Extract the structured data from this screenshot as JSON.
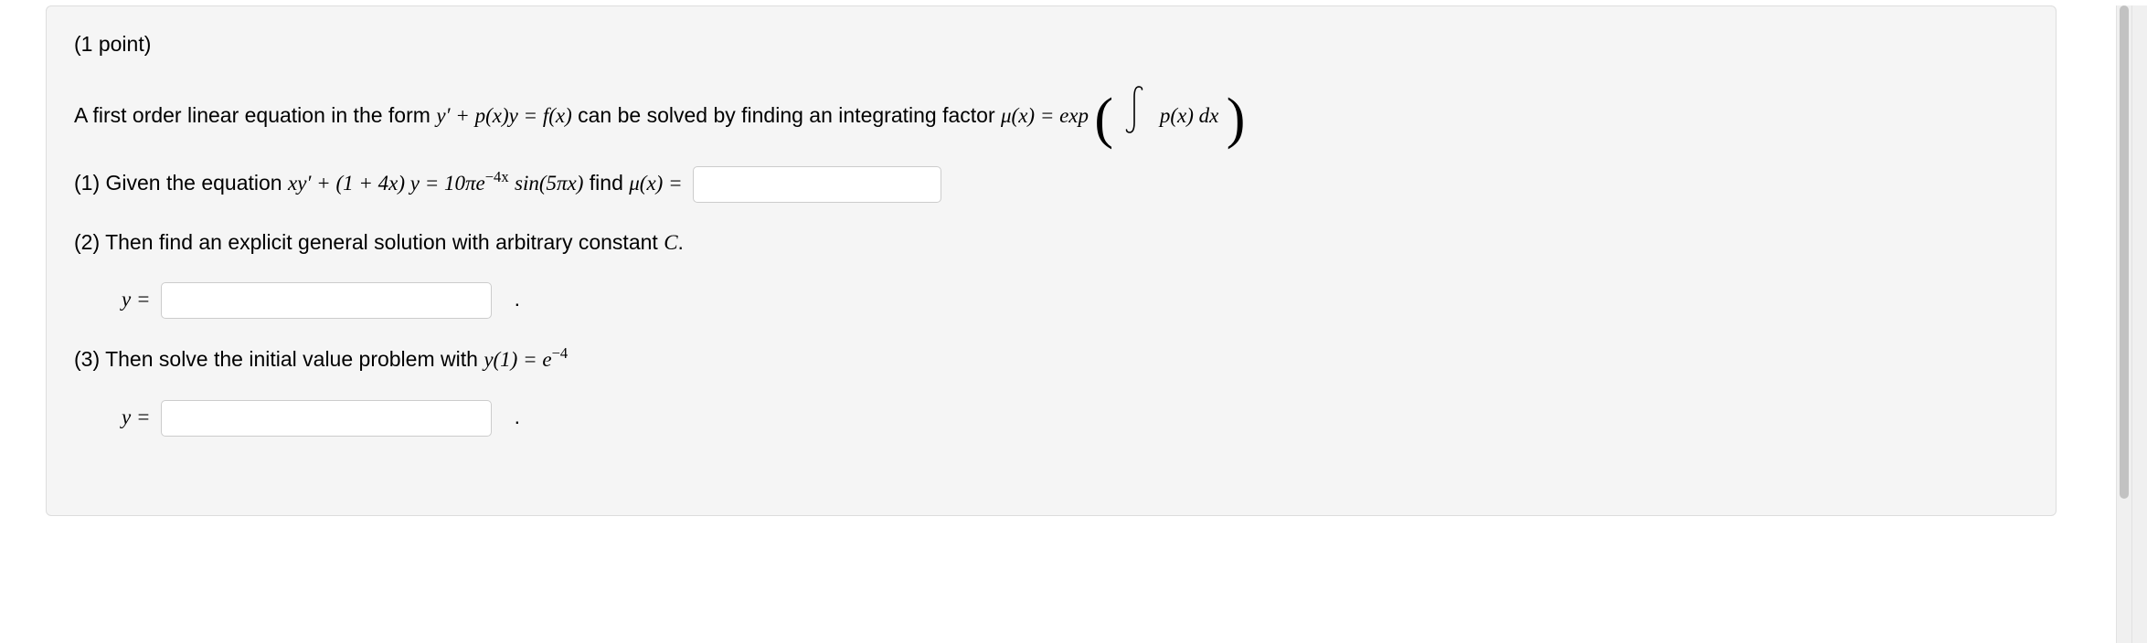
{
  "points_label": "(1 point)",
  "intro": {
    "pre": "A first order linear equation in the form ",
    "eq_lhs": "y′ + p(x)y = f(x)",
    "mid": " can be solved by finding an integrating factor ",
    "mu_eq": "μ(x) = exp",
    "int_body": "p(x) dx"
  },
  "q1": {
    "pre": "(1) Given the equation ",
    "eq": "xy′ + (1 + 4x) y = 10πe",
    "exp": "−4x",
    "mid": " sin(5πx)",
    "post": " find ",
    "mu": "μ(x) = "
  },
  "q2": {
    "text": "(2) Then find an explicit general solution with arbitrary constant ",
    "const": "C",
    "period": "."
  },
  "y_eq": "y = ",
  "q3": {
    "pre": "(3) Then solve the initial value problem with ",
    "cond": "y(1) = e",
    "exp": "−4"
  },
  "chart_data": {
    "type": "table",
    "title": "ODE integrating-factor problem",
    "equation_standard_form": "y' + p(x) y = f(x)",
    "integrating_factor_formula": "mu(x) = exp( ∫ p(x) dx )",
    "given_equation": "x y' + (1 + 4x) y = 10 π e^{-4x} sin(5 π x)",
    "unknowns": [
      "mu(x)",
      "general solution y(x,C)",
      "particular solution with y(1)=e^{-4}"
    ],
    "initial_condition": {
      "x": 1,
      "y": "e^{-4}"
    }
  }
}
